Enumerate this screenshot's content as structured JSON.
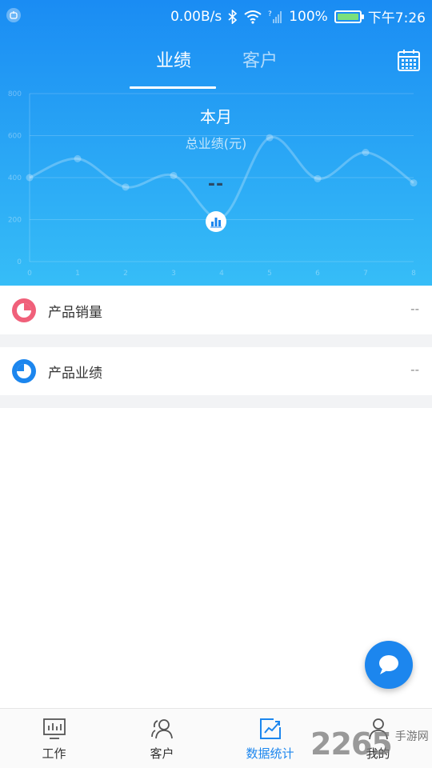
{
  "status_bar": {
    "network_speed": "0.00B/s",
    "battery_percent": "100%",
    "time": "下午7:26"
  },
  "tabs": [
    {
      "label": "业绩",
      "active": true
    },
    {
      "label": "客户",
      "active": false
    }
  ],
  "summary": {
    "period": "本月",
    "metric_label": "总业绩(元)",
    "metric_value": "--"
  },
  "chart_data": {
    "type": "line",
    "x": [
      0,
      1,
      2,
      3,
      4,
      5,
      6,
      7,
      8
    ],
    "series": [
      {
        "values": [
          400,
          490,
          355,
          410,
          210,
          590,
          395,
          520,
          375
        ]
      }
    ],
    "x_tick_labels": [
      "0",
      "1",
      "2",
      "3",
      "4",
      "5",
      "6",
      "7",
      "8"
    ],
    "y_tick_labels": [
      "0",
      "200",
      "400",
      "600",
      "800"
    ],
    "ylim": [
      0,
      800
    ],
    "grid": true
  },
  "rows": [
    {
      "label": "产品销量",
      "value": "--",
      "icon": "pie-chart-icon",
      "color": "#f0607a"
    },
    {
      "label": "产品业绩",
      "value": "--",
      "icon": "donut-chart-icon",
      "color": "#1c86ee"
    }
  ],
  "bottom_nav": [
    {
      "label": "工作",
      "icon": "dashboard-icon",
      "active": false
    },
    {
      "label": "客户",
      "icon": "users-icon",
      "active": false
    },
    {
      "label": "数据统计",
      "icon": "trend-chart-icon",
      "active": true
    },
    {
      "label": "我的",
      "icon": "user-icon",
      "active": false
    }
  ],
  "watermark": {
    "number": "2265",
    "text": "手游网"
  },
  "colors": {
    "accent": "#1c86ee",
    "header_top": "#1a8cf3",
    "header_bottom": "#36bdf7"
  }
}
